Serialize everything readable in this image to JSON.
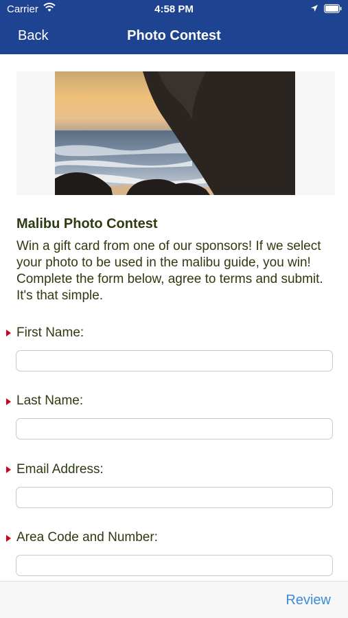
{
  "status_bar": {
    "carrier": "Carrier",
    "time": "4:58 PM"
  },
  "nav": {
    "back_label": "Back",
    "title": "Photo Contest"
  },
  "contest": {
    "title": "Malibu Photo Contest",
    "description": "Win a gift card from one of our sponsors! If we select your photo to be used in the malibu guide, you win! Complete the form below, agree to terms and submit. It's that simple."
  },
  "form": {
    "fields": [
      {
        "label": "First Name:",
        "value": ""
      },
      {
        "label": "Last Name:",
        "value": ""
      },
      {
        "label": "Email Address:",
        "value": ""
      },
      {
        "label": "Area Code and Number:",
        "value": ""
      }
    ]
  },
  "toolbar": {
    "review_label": "Review"
  },
  "colors": {
    "header_bg": "#1e4390",
    "required_marker": "#d0021b",
    "text": "#2e3a10",
    "link": "#3d8bd6"
  }
}
